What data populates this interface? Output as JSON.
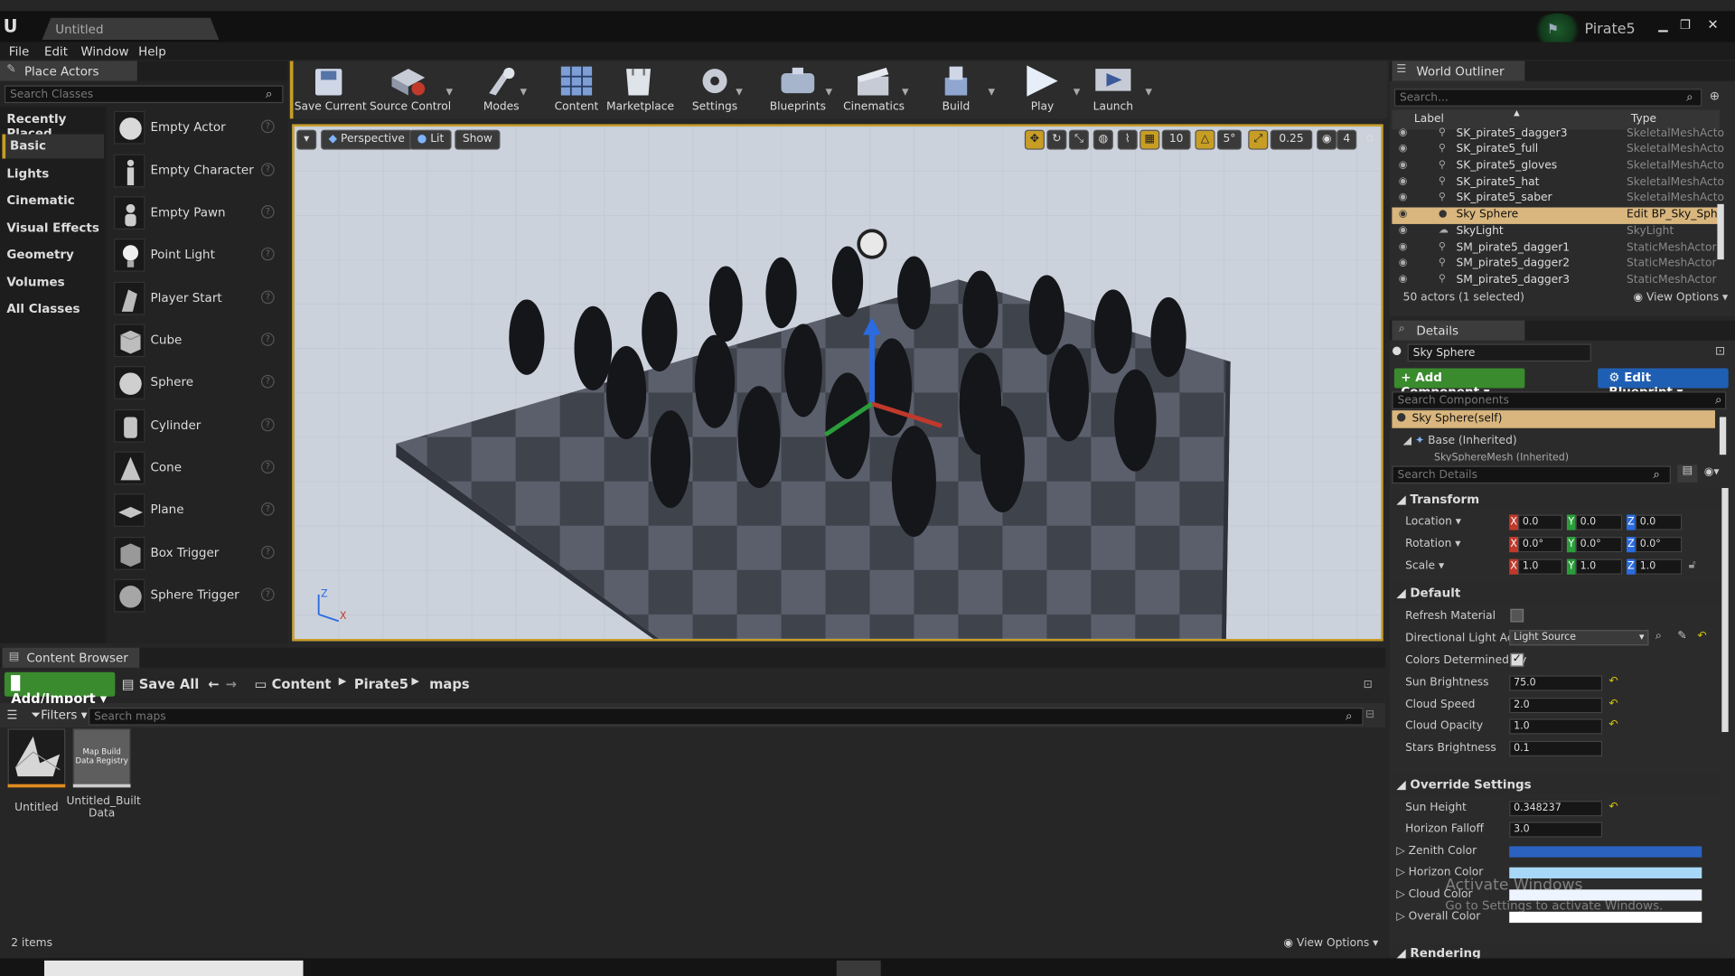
{
  "window": {
    "title": "Untitled",
    "project": "Pirate5",
    "win_min": "▁",
    "win_max": "❐",
    "win_close": "✕"
  },
  "menu": [
    "File",
    "Edit",
    "Window",
    "Help"
  ],
  "place_actors": {
    "tab": "Place Actors",
    "search_placeholder": "Search Classes",
    "categories": [
      "Recently Placed",
      "Basic",
      "Lights",
      "Cinematic",
      "Visual Effects",
      "Geometry",
      "Volumes",
      "All Classes"
    ],
    "actors": [
      "Empty Actor",
      "Empty Character",
      "Empty Pawn",
      "Point Light",
      "Player Start",
      "Cube",
      "Sphere",
      "Cylinder",
      "Cone",
      "Plane",
      "Box Trigger",
      "Sphere Trigger"
    ]
  },
  "toolbar": {
    "buttons": [
      "Save Current",
      "Source Control",
      "Modes",
      "Content",
      "Marketplace",
      "Settings",
      "Blueprints",
      "Cinematics",
      "Build",
      "Play",
      "Launch"
    ]
  },
  "viewport": {
    "perspective": "Perspective",
    "lit": "Lit",
    "show": "Show",
    "grid_snap": "10",
    "rot_snap": "5°",
    "scale_snap": "0.25",
    "cam_speed": "4",
    "axis_z": "Z",
    "axis_x": "X"
  },
  "outliner": {
    "tab": "World Outliner",
    "search_placeholder": "Search...",
    "col_label": "Label",
    "col_type": "Type",
    "rows": [
      {
        "label": "SK_pirate5_dagger3",
        "type": "SkeletalMeshActo"
      },
      {
        "label": "SK_pirate5_full",
        "type": "SkeletalMeshActo"
      },
      {
        "label": "SK_pirate5_gloves",
        "type": "SkeletalMeshActo"
      },
      {
        "label": "SK_pirate5_hat",
        "type": "SkeletalMeshActo"
      },
      {
        "label": "SK_pirate5_saber",
        "type": "SkeletalMeshActo"
      },
      {
        "label": "Sky Sphere",
        "type": "Edit BP_Sky_Sph"
      },
      {
        "label": "SkyLight",
        "type": "SkyLight"
      },
      {
        "label": "SM_pirate5_dagger1",
        "type": "StaticMeshActor"
      },
      {
        "label": "SM_pirate5_dagger2",
        "type": "StaticMeshActor"
      },
      {
        "label": "SM_pirate5_dagger3",
        "type": "StaticMeshActor"
      }
    ],
    "status": "50 actors (1 selected)",
    "view_options": "View Options"
  },
  "details": {
    "tab": "Details",
    "name": "Sky Sphere",
    "add_component": "+ Add Component",
    "edit_blueprint": "Edit Blueprint",
    "search_components": "Search Components",
    "comp_self": "Sky Sphere(self)",
    "comp_base": "Base (Inherited)",
    "comp_mesh": "SkySphereMesh (Inherited)",
    "search_details": "Search Details",
    "transform": {
      "title": "Transform",
      "location": "Location",
      "rotation": "Rotation",
      "scale": "Scale",
      "loc": [
        "0.0",
        "0.0",
        "0.0"
      ],
      "rot": [
        "0.0°",
        "0.0°",
        "0.0°"
      ],
      "scl": [
        "1.0",
        "1.0",
        "1.0"
      ]
    },
    "default": {
      "title": "Default",
      "refresh_material": "Refresh Material",
      "directional_light": "Directional Light Actor",
      "light_source": "Light Source",
      "colors_determined": "Colors Determined By",
      "sun_brightness": "Sun Brightness",
      "sun_brightness_v": "75.0",
      "cloud_speed": "Cloud Speed",
      "cloud_speed_v": "2.0",
      "cloud_opacity": "Cloud Opacity",
      "cloud_opacity_v": "1.0",
      "stars_brightness": "Stars Brightness",
      "stars_brightness_v": "0.1"
    },
    "override": {
      "title": "Override Settings",
      "sun_height": "Sun Height",
      "sun_height_v": "0.348237",
      "horizon_falloff": "Horizon Falloff",
      "horizon_falloff_v": "3.0",
      "zenith_color": "Zenith Color",
      "horizon_color": "Horizon Color",
      "cloud_color": "Cloud Color",
      "overall_color": "Overall Color",
      "colors": {
        "zenith": "#2b62c0",
        "horizon": "#a8d8f8",
        "cloud": "#eef4ff",
        "overall": "#ffffff"
      }
    },
    "rendering": "Rendering"
  },
  "content_browser": {
    "tab": "Content Browser",
    "add_import": "Add/Import",
    "save_all": "Save All",
    "path": [
      "Content",
      "Pirate5",
      "maps"
    ],
    "filters": "Filters",
    "search_placeholder": "Search maps",
    "assets": [
      {
        "name": "Untitled",
        "thumb": ""
      },
      {
        "name": "Untitled_Built\nData",
        "thumb": "Map Build\nData Registry"
      }
    ],
    "count": "2 items",
    "view_options": "View Options"
  },
  "watermark": {
    "line1": "Activate Windows",
    "line2": "Go to Settings to activate Windows."
  }
}
